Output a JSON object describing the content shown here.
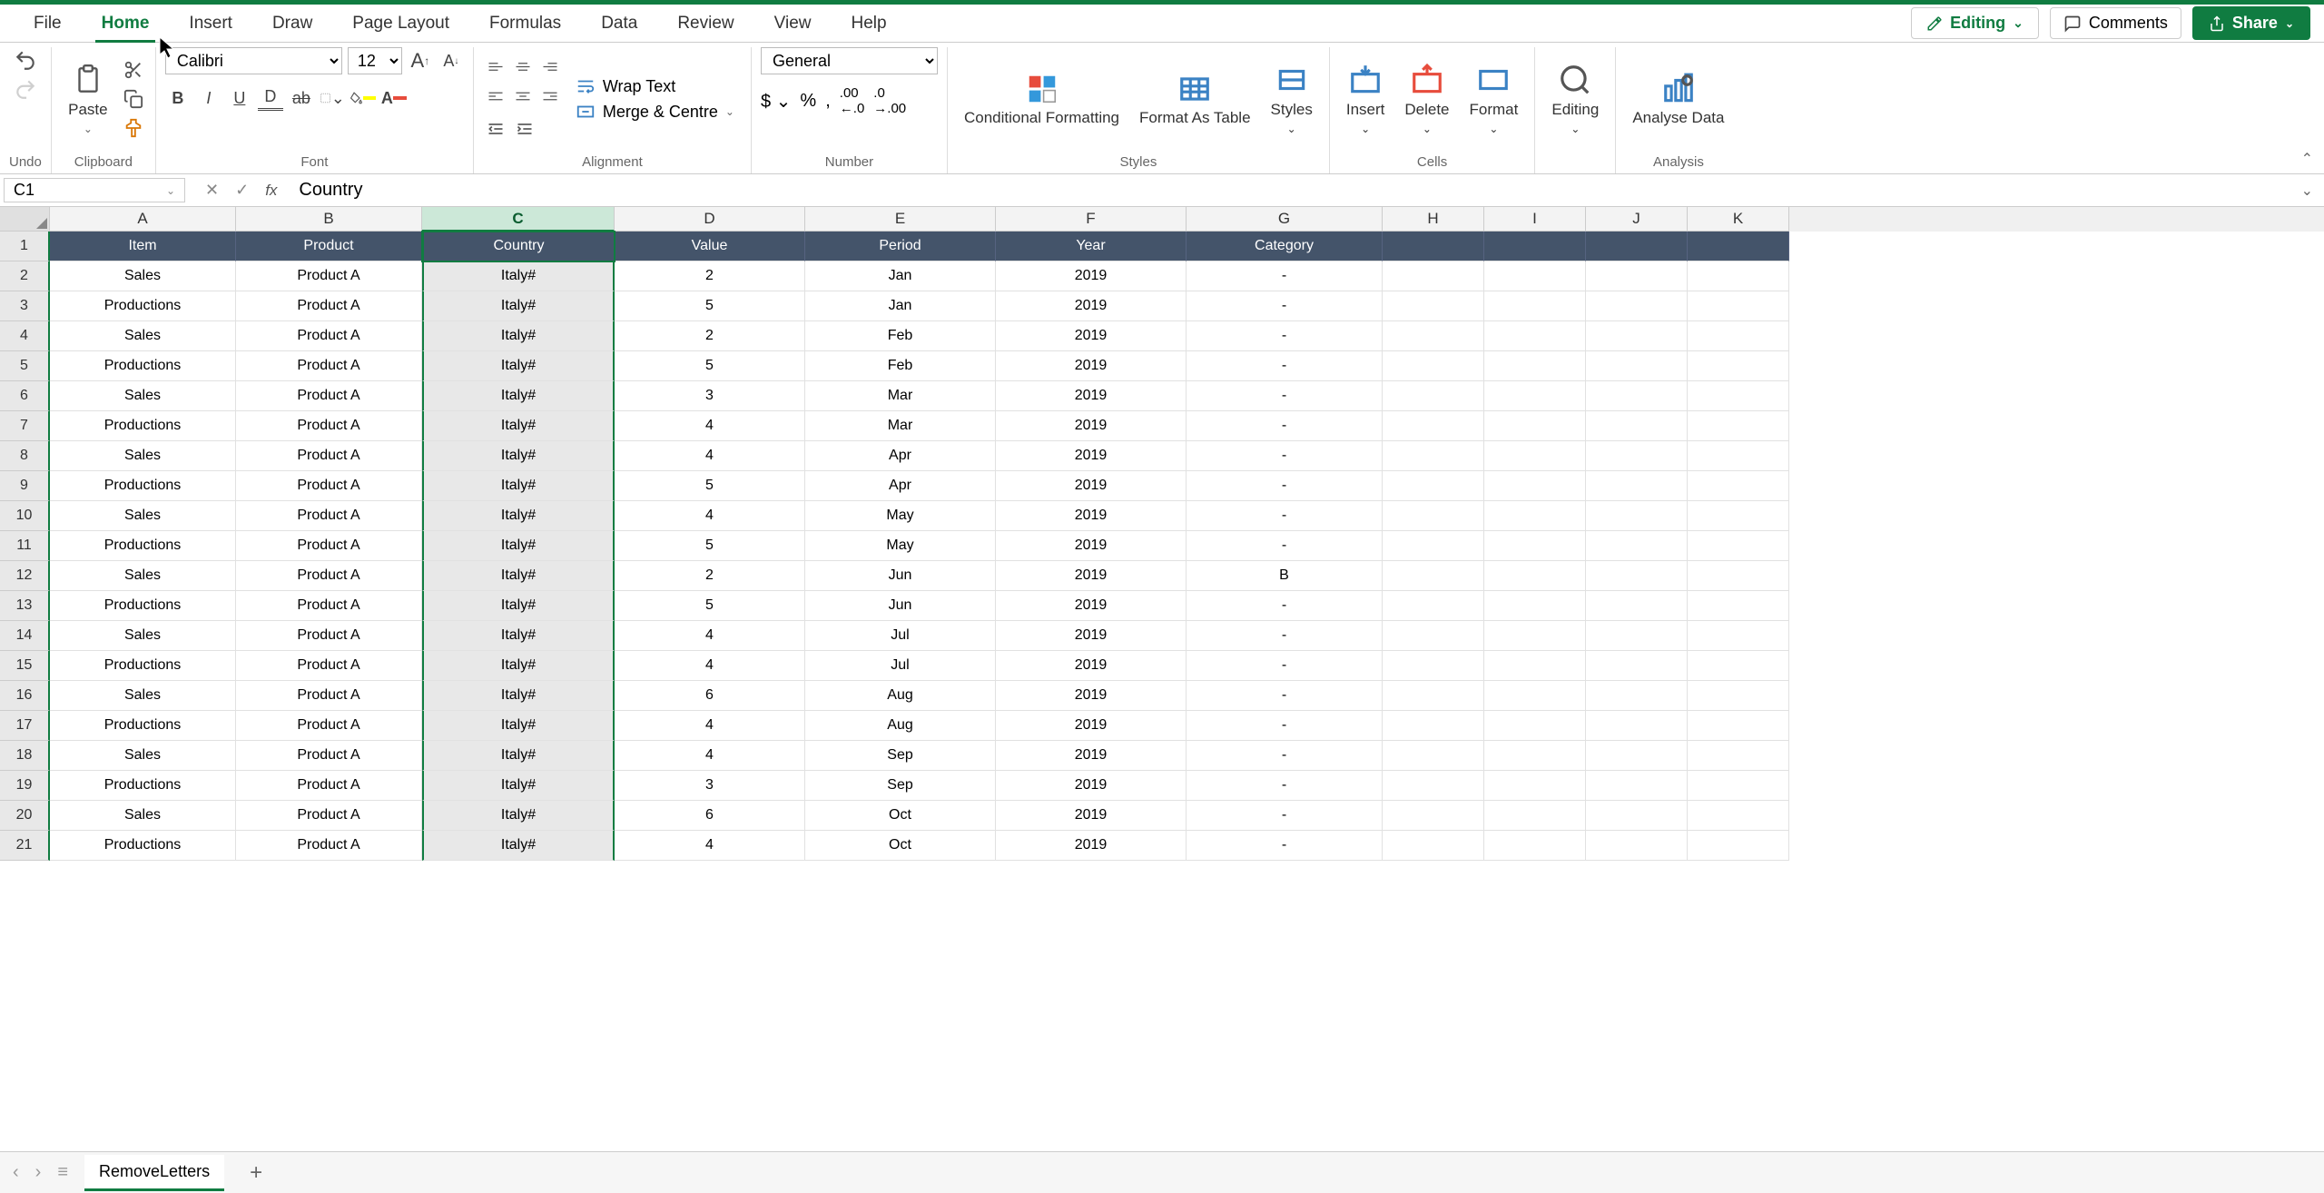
{
  "menu": {
    "tabs": [
      "File",
      "Home",
      "Insert",
      "Draw",
      "Page Layout",
      "Formulas",
      "Data",
      "Review",
      "View",
      "Help"
    ],
    "active": "Home",
    "mode": "Editing",
    "comments": "Comments",
    "share": "Share"
  },
  "ribbon": {
    "undo_label": "Undo",
    "clipboard": {
      "paste": "Paste",
      "label": "Clipboard"
    },
    "font": {
      "name": "Calibri",
      "size": "12",
      "label": "Font"
    },
    "alignment": {
      "wrap": "Wrap Text",
      "merge": "Merge & Centre",
      "label": "Alignment"
    },
    "number": {
      "format": "General",
      "label": "Number"
    },
    "styles": {
      "cf": "Conditional Formatting",
      "fat": "Format As Table",
      "cs": "Styles",
      "label": "Styles"
    },
    "cells": {
      "insert": "Insert",
      "delete": "Delete",
      "format": "Format",
      "label": "Cells"
    },
    "editing": {
      "editing": "Editing",
      "label": ""
    },
    "analysis": {
      "analyse": "Analyse Data",
      "label": "Analysis"
    }
  },
  "formula_bar": {
    "name_box": "C1",
    "value": "Country"
  },
  "columns": [
    "A",
    "B",
    "C",
    "D",
    "E",
    "F",
    "G",
    "H",
    "I",
    "J",
    "K"
  ],
  "selected_column": "C",
  "table_headers": [
    "Item",
    "Product",
    "Country",
    "Value",
    "Period",
    "Year",
    "Category"
  ],
  "rows": [
    {
      "n": 1,
      "cells": [
        "Item",
        "Product",
        "Country",
        "Value",
        "Period",
        "Year",
        "Category"
      ],
      "hdr": true
    },
    {
      "n": 2,
      "cells": [
        "Sales",
        "Product A",
        "Italy#",
        "2",
        "Jan",
        "2019",
        "-"
      ]
    },
    {
      "n": 3,
      "cells": [
        "Productions",
        "Product A",
        "Italy#",
        "5",
        "Jan",
        "2019",
        "-"
      ]
    },
    {
      "n": 4,
      "cells": [
        "Sales",
        "Product A",
        "Italy#",
        "2",
        "Feb",
        "2019",
        "-"
      ]
    },
    {
      "n": 5,
      "cells": [
        "Productions",
        "Product A",
        "Italy#",
        "5",
        "Feb",
        "2019",
        "-"
      ]
    },
    {
      "n": 6,
      "cells": [
        "Sales",
        "Product A",
        "Italy#",
        "3",
        "Mar",
        "2019",
        "-"
      ]
    },
    {
      "n": 7,
      "cells": [
        "Productions",
        "Product A",
        "Italy#",
        "4",
        "Mar",
        "2019",
        "-"
      ]
    },
    {
      "n": 8,
      "cells": [
        "Sales",
        "Product A",
        "Italy#",
        "4",
        "Apr",
        "2019",
        "-"
      ]
    },
    {
      "n": 9,
      "cells": [
        "Productions",
        "Product A",
        "Italy#",
        "5",
        "Apr",
        "2019",
        "-"
      ]
    },
    {
      "n": 10,
      "cells": [
        "Sales",
        "Product A",
        "Italy#",
        "4",
        "May",
        "2019",
        "-"
      ]
    },
    {
      "n": 11,
      "cells": [
        "Productions",
        "Product A",
        "Italy#",
        "5",
        "May",
        "2019",
        "-"
      ]
    },
    {
      "n": 12,
      "cells": [
        "Sales",
        "Product A",
        "Italy#",
        "2",
        "Jun",
        "2019",
        "B"
      ]
    },
    {
      "n": 13,
      "cells": [
        "Productions",
        "Product A",
        "Italy#",
        "5",
        "Jun",
        "2019",
        "-"
      ]
    },
    {
      "n": 14,
      "cells": [
        "Sales",
        "Product A",
        "Italy#",
        "4",
        "Jul",
        "2019",
        "-"
      ]
    },
    {
      "n": 15,
      "cells": [
        "Productions",
        "Product A",
        "Italy#",
        "4",
        "Jul",
        "2019",
        "-"
      ]
    },
    {
      "n": 16,
      "cells": [
        "Sales",
        "Product A",
        "Italy#",
        "6",
        "Aug",
        "2019",
        "-"
      ]
    },
    {
      "n": 17,
      "cells": [
        "Productions",
        "Product A",
        "Italy#",
        "4",
        "Aug",
        "2019",
        "-"
      ]
    },
    {
      "n": 18,
      "cells": [
        "Sales",
        "Product A",
        "Italy#",
        "4",
        "Sep",
        "2019",
        "-"
      ]
    },
    {
      "n": 19,
      "cells": [
        "Productions",
        "Product A",
        "Italy#",
        "3",
        "Sep",
        "2019",
        "-"
      ]
    },
    {
      "n": 20,
      "cells": [
        "Sales",
        "Product A",
        "Italy#",
        "6",
        "Oct",
        "2019",
        "-"
      ]
    },
    {
      "n": 21,
      "cells": [
        "Productions",
        "Product A",
        "Italy#",
        "4",
        "Oct",
        "2019",
        "-"
      ]
    }
  ],
  "sheet_tabs": {
    "active": "RemoveLetters"
  }
}
